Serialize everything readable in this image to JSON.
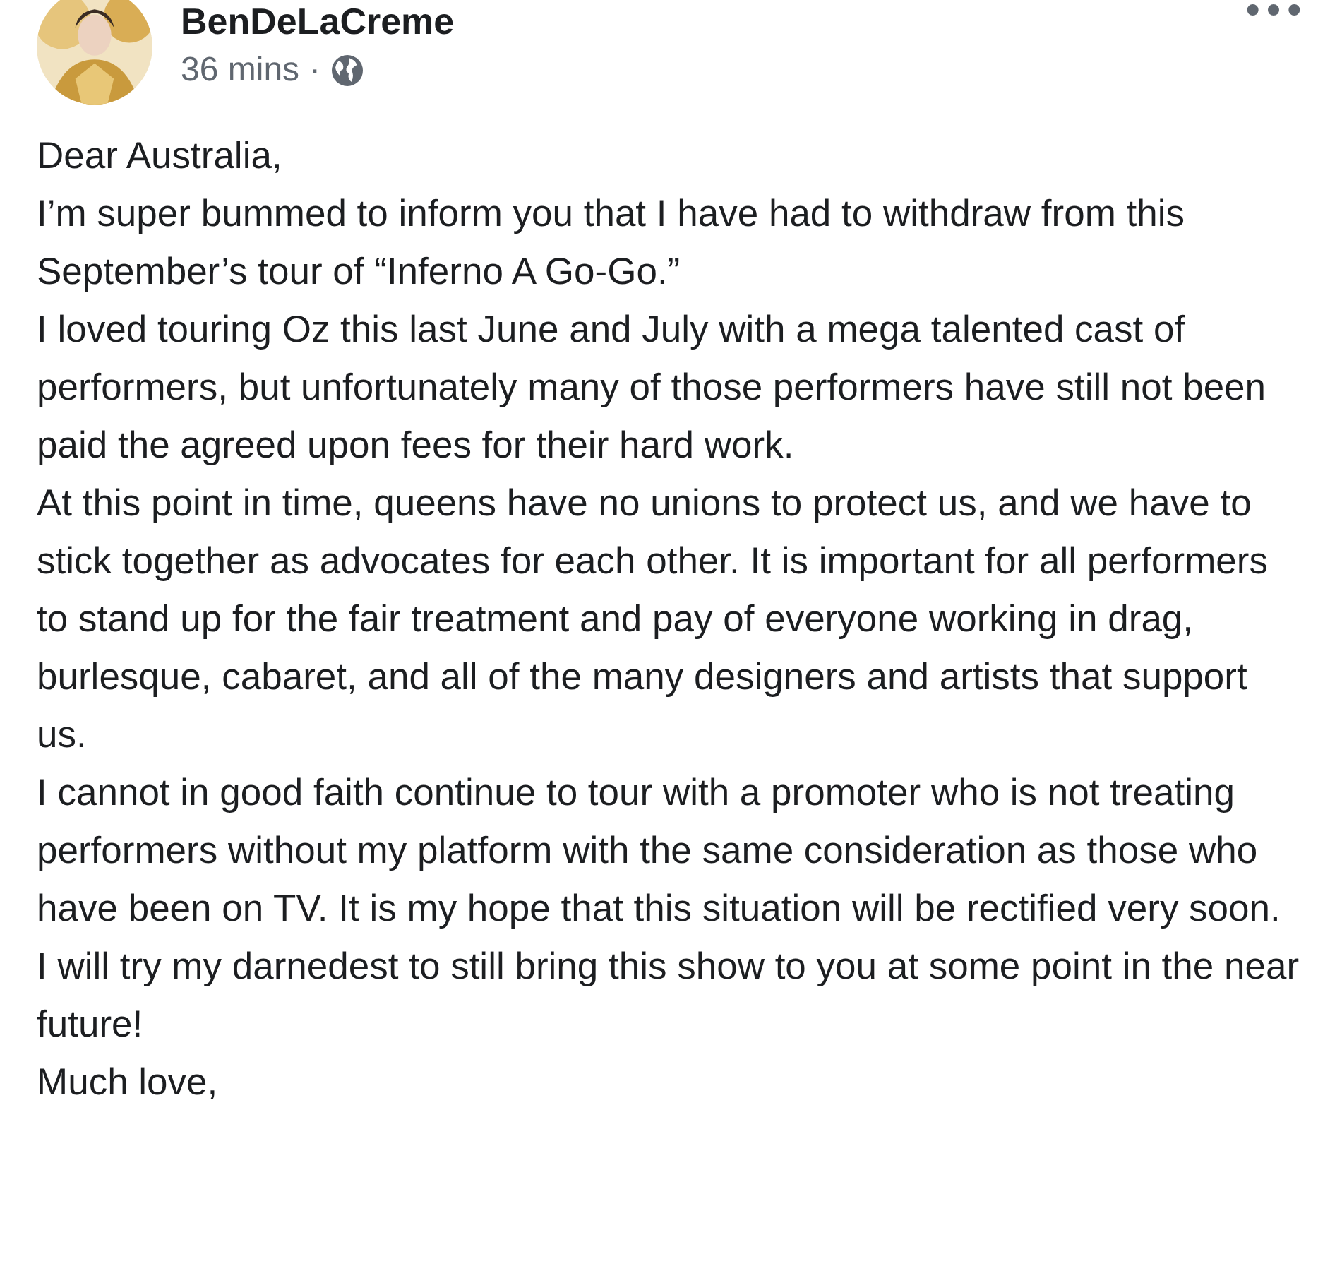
{
  "post": {
    "author": "BenDeLaCreme",
    "time": "36 mins",
    "separator": "·",
    "paragraphs": [
      "Dear Australia,",
      "I’m super bummed to inform you that I have had to withdraw from this September’s tour of “Inferno A Go-Go.”",
      "I loved touring Oz this last June and July with a mega talented cast of performers, but unfortunately many of those performers have still not been paid the agreed upon fees for their hard work.",
      "At this point in time, queens have no unions to protect us, and we have to stick together as advocates for each other. It is important for all performers to stand up for the fair treatment and pay of everyone working in drag, burlesque, cabaret, and all of the many designers and artists that support us.",
      "I cannot in good faith continue to tour with a promoter who is not treating performers without my platform with the same consideration as those who have been on TV. It is my hope that this situation will be rectified very soon.",
      "I will try my darnedest to still bring this show to you at some point in the near future!",
      "Much love,"
    ]
  }
}
